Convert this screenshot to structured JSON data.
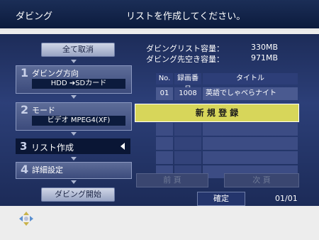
{
  "header": {
    "title": "ダビング",
    "message": "リストを作成してください。"
  },
  "left": {
    "cancel_all": "全て取消",
    "steps": [
      {
        "num": "1",
        "label": "ダビング方向",
        "value": "HDD ➔SDカード"
      },
      {
        "num": "2",
        "label": "モード",
        "value": "ビデオ MPEG4(XF)"
      },
      {
        "num": "3",
        "label": "リスト作成"
      },
      {
        "num": "4",
        "label": "詳細設定"
      }
    ],
    "start": "ダビング開始"
  },
  "info": {
    "list_capacity_label": "ダビングリスト容量：",
    "list_capacity_value": "330MB",
    "free_label": "ダビング先空き容量：",
    "free_value": "971MB"
  },
  "table": {
    "headers": [
      "No.",
      "録画番号",
      "タイトル"
    ],
    "rows": [
      {
        "no": "01",
        "rec": "1008",
        "title": "英語でしゃべらナイト"
      }
    ],
    "new_register": "新 規 登 録"
  },
  "footer": {
    "prev": "前 頁",
    "next": "次 頁",
    "confirm": "確定",
    "page": "01/01"
  },
  "colors": {
    "accent": "#d7d65a",
    "panel": "#2c3f78",
    "header": "#0c1b3d"
  }
}
